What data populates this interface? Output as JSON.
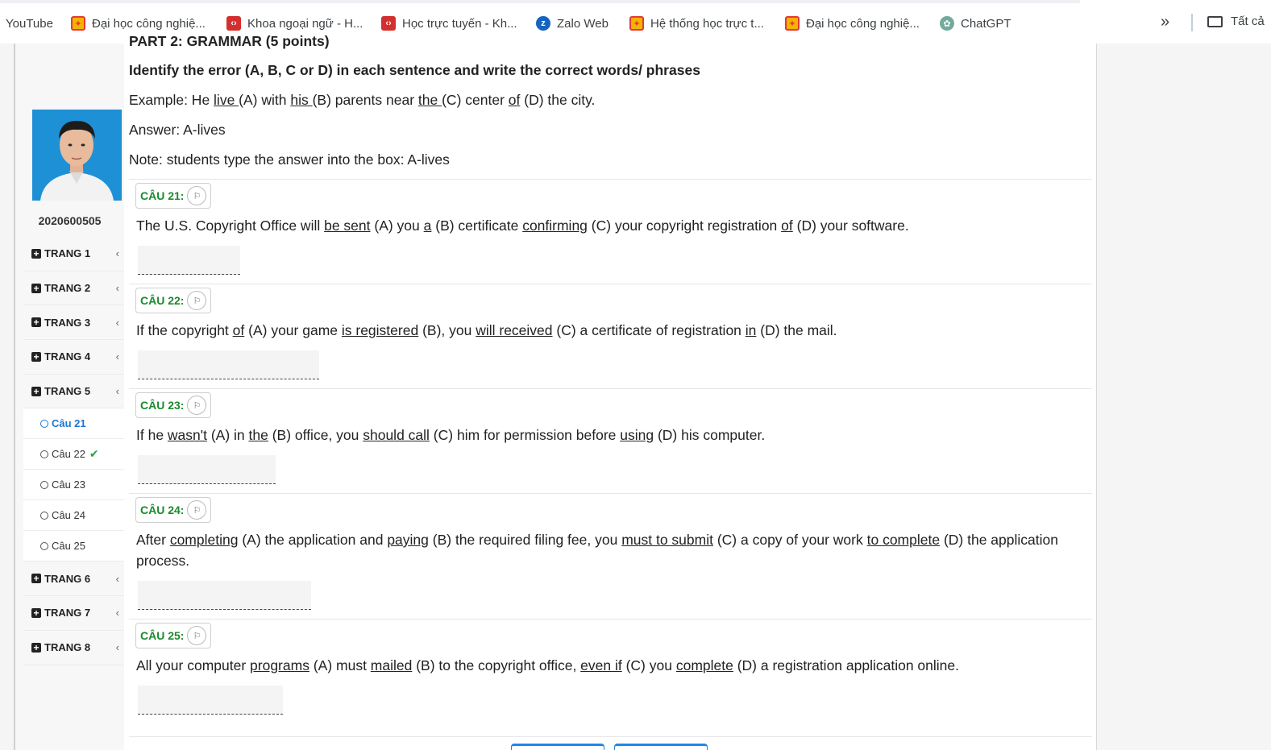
{
  "bookmarks": {
    "items": [
      {
        "label": "YouTube",
        "icon": "none"
      },
      {
        "label": "Đại học công nghiệ...",
        "icon": "university-logo-icon"
      },
      {
        "label": "Khoa ngoại ngữ - H...",
        "icon": "code-icon"
      },
      {
        "label": "Học trực tuyến - Kh...",
        "icon": "code-icon"
      },
      {
        "label": "Zalo Web",
        "icon": "zalo-icon"
      },
      {
        "label": "Hệ thống học trực t...",
        "icon": "university-logo-icon"
      },
      {
        "label": "Đại học công nghiệ...",
        "icon": "university-logo-icon"
      },
      {
        "label": "ChatGPT",
        "icon": "chatgpt-icon"
      }
    ],
    "overflow": "»",
    "folder_label": "Tất cả"
  },
  "sidebar": {
    "student_id": "2020600505",
    "pages": [
      {
        "label": "TRANG 1"
      },
      {
        "label": "TRANG 2"
      },
      {
        "label": "TRANG 3"
      },
      {
        "label": "TRANG 4"
      },
      {
        "label": "TRANG 5"
      }
    ],
    "questions": [
      {
        "label": "Câu 21",
        "active": true
      },
      {
        "label": "Câu 22",
        "answered": true
      },
      {
        "label": "Câu 23"
      },
      {
        "label": "Câu 24"
      },
      {
        "label": "Câu 25"
      }
    ],
    "pages_after": [
      {
        "label": "TRANG 6"
      },
      {
        "label": "TRANG 7"
      },
      {
        "label": "TRANG 8"
      }
    ]
  },
  "main": {
    "part_title": "PART 2: GRAMMAR (5 points)",
    "instruction": "Identify the error (A, B, C or D) in each sentence and write the correct words/ phrases",
    "example": {
      "prefix": "Example: He ",
      "w1": "live ",
      "t1": "(A) with ",
      "w2": "his ",
      "t2": "(B) parents near ",
      "w3": "the ",
      "t3": "(C) center ",
      "w4": "of",
      "t4": " (D) the city."
    },
    "answer_line": "Answer: A-lives",
    "note_line": "Note: students type the answer into the box: A-lives",
    "questions": [
      {
        "label": "CÂU 21:",
        "parts": [
          "The U.S. Copyright Office will ",
          "be sent",
          " (A) you ",
          "a",
          " (B) certificate ",
          "confirming",
          " (C) your copyright registration ",
          "of",
          " (D) your software."
        ],
        "answer": ""
      },
      {
        "label": "CÂU 22:",
        "parts": [
          "If the copyright ",
          "of",
          " (A) your game ",
          "is registered",
          " (B), you ",
          "will received",
          " (C) a certificate of registration ",
          "in",
          " (D) the mail."
        ],
        "answer": ""
      },
      {
        "label": "CÂU 23:",
        "parts": [
          "If he ",
          "wasn't",
          " (A) in ",
          "the",
          " (B) office, you ",
          "should call",
          " (C) him for permission before ",
          "using",
          " (D) his computer."
        ],
        "answer": ""
      },
      {
        "label": "CÂU 24:",
        "parts": [
          "After ",
          "completing",
          " (A) the application and ",
          "paying",
          " (B) the required filing fee, you ",
          "must to submit",
          " (C) a copy of your work ",
          "to complete",
          " (D) the application process."
        ],
        "answer": ""
      },
      {
        "label": "CÂU 25:",
        "parts": [
          "All your computer ",
          "programs",
          " (A) must ",
          "mailed",
          " (B) to the copyright office, ",
          "even if",
          " (C) you ",
          "complete",
          " (D) a registration application online."
        ],
        "answer": ""
      }
    ]
  }
}
